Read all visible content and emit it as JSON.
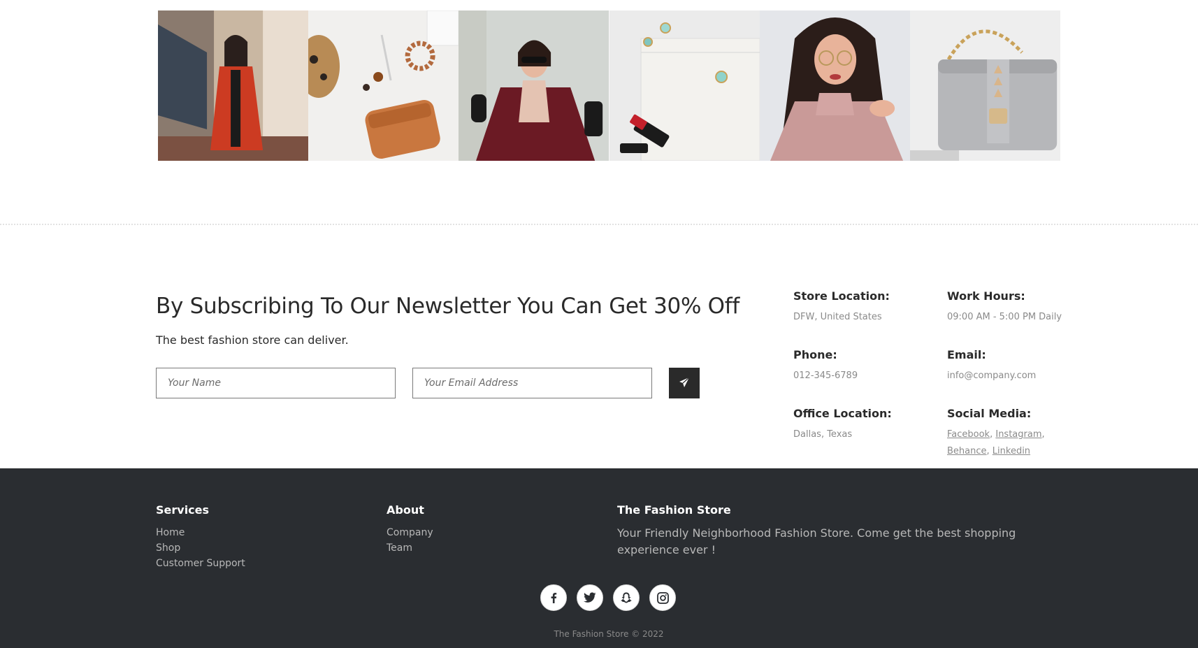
{
  "gallery": {
    "images": [
      {
        "icon": "woman-red-coat-photo"
      },
      {
        "icon": "leather-wallet-accessories-photo"
      },
      {
        "icon": "woman-burgundy-coat-sunglasses-photo"
      },
      {
        "icon": "white-clutch-lipstick-earrings-photo"
      },
      {
        "icon": "woman-pink-jacket-glasses-photo"
      },
      {
        "icon": "grey-studded-handbag-photo"
      }
    ]
  },
  "subscribe": {
    "heading": "By Subscribing To Our Newsletter You Can Get 30% Off",
    "subtext": "The best fashion store can deliver.",
    "name_placeholder": "Your Name",
    "email_placeholder": "Your Email Address",
    "submit_icon": "paper-plane-icon"
  },
  "contact": {
    "store_location": {
      "label": "Store Location:",
      "value": "DFW, United States"
    },
    "work_hours": {
      "label": "Work Hours:",
      "value": "09:00 AM - 5:00 PM Daily"
    },
    "phone": {
      "label": "Phone:",
      "value": "012-345-6789"
    },
    "email": {
      "label": "Email:",
      "value": "info@company.com"
    },
    "office_location": {
      "label": "Office Location:",
      "value": "Dallas, Texas"
    },
    "social_media": {
      "label": "Social Media:",
      "links": [
        "Facebook",
        "Instagram",
        "Behance",
        "Linkedin"
      ]
    }
  },
  "footer": {
    "services": {
      "title": "Services",
      "items": [
        "Home",
        "Shop",
        "Customer Support"
      ]
    },
    "about": {
      "title": "About",
      "items": [
        "Company",
        "Team"
      ]
    },
    "store": {
      "title": "The Fashion Store",
      "description": "Your Friendly Neighborhood Fashion Store. Come get the best shopping experience ever !"
    },
    "social_icons": [
      "facebook-icon",
      "twitter-icon",
      "snapchat-icon",
      "instagram-icon"
    ],
    "copyright": "The Fashion Store © 2022"
  },
  "colors": {
    "footer_bg": "#2a2d31",
    "text_dark": "#2a2a2a",
    "text_muted": "#8a8a8a",
    "button_bg": "#2a2a2a"
  }
}
